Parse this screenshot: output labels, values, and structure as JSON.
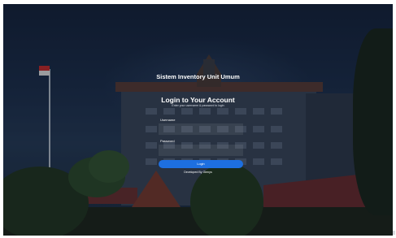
{
  "app": {
    "title": "Sistem Inventory Unit Umum"
  },
  "login": {
    "heading": "Login to Your Account",
    "subtitle": "Enter your username & password to login",
    "username_label": "Username",
    "username_value": "",
    "password_label": "Password",
    "password_value": "",
    "button_label": "Login"
  },
  "footer": {
    "credit": "Developed By Glenys"
  },
  "colors": {
    "accent": "#1d6fe0",
    "text": "#ffffff",
    "overlay": "#13213a"
  }
}
